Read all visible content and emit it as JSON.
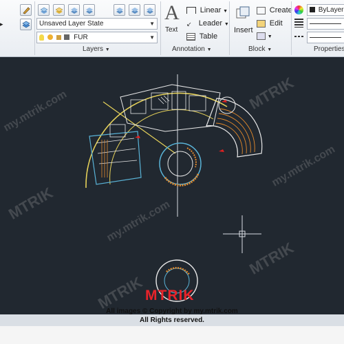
{
  "layers": {
    "state_value": "Unsaved Layer State",
    "current_layer": "FUR",
    "title": "Layers"
  },
  "annotation": {
    "text_label": "Text",
    "linear_label": "Linear",
    "leader_label": "Leader",
    "table_label": "Table",
    "title": "Annotation"
  },
  "block": {
    "insert_label": "Insert",
    "create_label": "Create",
    "edit_label": "Edit",
    "title": "Block"
  },
  "properties": {
    "color_value": "ByLayer",
    "title": "Properties"
  },
  "watermark": {
    "brand": "MTRIK",
    "site": "my.mtrik.com",
    "copyright_line1": "All images © Copyright by my.mtrik.com",
    "copyright_line2": "All Rights reserved."
  },
  "icons": [
    "pencil-icon",
    "layer-stack-icon",
    "layer-settings-icon",
    "bulb-icon",
    "sun-icon",
    "lock-icon",
    "color-square-icon",
    "matchprop-icon",
    "text-A-icon",
    "insert-block-icon",
    "create-block-icon",
    "edit-block-icon",
    "color-wheel-icon",
    "lineweight-icon"
  ],
  "colors": {
    "viewport_bg": "#212830",
    "crosshair": "#d9dde3",
    "drawing_yellow": "#e6d25a",
    "drawing_cyan": "#5ab4d8",
    "drawing_white": "#e9e9e9",
    "drawing_orange": "#e48a2c",
    "drawing_red": "#e02020",
    "logo_red": "#e8232a"
  }
}
